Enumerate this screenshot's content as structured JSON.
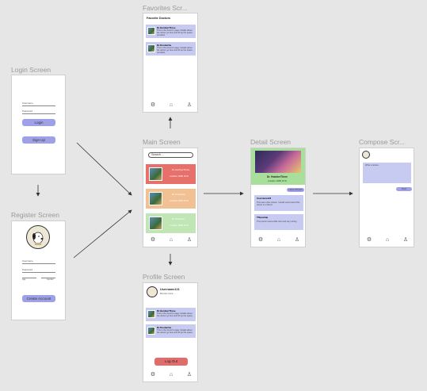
{
  "screens": {
    "login": {
      "label": "Login Screen",
      "username_label": "Username",
      "password_label": "Password",
      "login_button": "Login",
      "signup_button": "Sign Up"
    },
    "register": {
      "label": "Register Screen",
      "username_label": "Username",
      "password_label": "Password",
      "create_button": "Create Account",
      "field_hint_left": "Age",
      "field_hint_right": "Gender"
    },
    "favorites": {
      "label": "Favorites Scr...",
      "title": "Favorite Doctors",
      "items": [
        {
          "name": "Dr.HumberThree",
          "desc": "This is the doctor's page. Details about the doctor go here and fill up the space provided."
        },
        {
          "name": "Dr.Knobertia",
          "desc": "This is the doctor's page. Details about the doctor go here and fill up the space provided."
        }
      ]
    },
    "main": {
      "label": "Main Screen",
      "search_placeholder": "Search ...",
      "items": [
        {
          "name": "Dr.HumberThree",
          "sub": "Location: ERB, Rt St",
          "color": "#e8706a"
        },
        {
          "name": "Dr.Knobertia",
          "sub": "Location: ERB, Rt St",
          "color": "#f2c193"
        },
        {
          "name": "Dr.Humberli",
          "sub": "Location: ERB, Rt St",
          "color": "#bfe6b4"
        }
      ]
    },
    "detail": {
      "label": "Detail Screen",
      "name": "Dr. HumberThree",
      "sub": "Location: ERB, Rt St",
      "tag_button": "Leave a Review",
      "reviews": [
        {
          "user": "Username123",
          "text": "This was a fine review. I would recommend this doctor to a friend."
        },
        {
          "user": "TiSpeedup",
          "text": "This person was a little nice and very caring."
        }
      ]
    },
    "compose": {
      "label": "Compose Scr...",
      "placeholder": "Write a review...",
      "post_button": "Post"
    },
    "profile": {
      "label": "Profile Screen",
      "username": "Username121",
      "sub": "Member since: ...",
      "logout_button": "Log Out",
      "items": [
        {
          "name": "Dr.HumberThree",
          "desc": "This is the doctor's page. Details about the doctor go here and fill up the space."
        },
        {
          "name": "Dr.Knobertia",
          "desc": "This is the doctor's page. Details about the doctor go here and fill up the space."
        }
      ]
    }
  },
  "colors": {
    "accent": "#9ea1e8",
    "danger": "#e26c6c",
    "card": "#c8cbf1",
    "detail_header": "#a8e09b",
    "canvas": "#e6e6e6"
  },
  "icons": {
    "nav": [
      "gear-icon",
      "home-icon",
      "user-icon"
    ]
  }
}
